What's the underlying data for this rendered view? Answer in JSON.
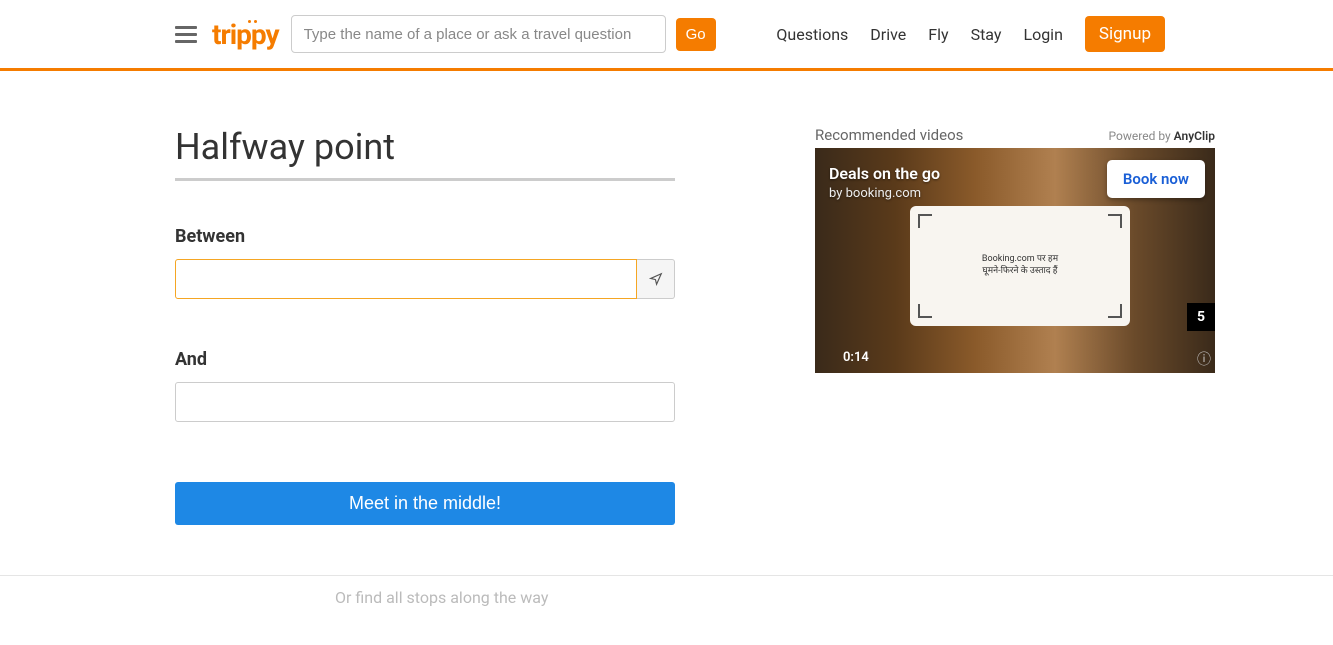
{
  "header": {
    "logo": "trippy",
    "search_placeholder": "Type the name of a place or ask a travel question",
    "go_label": "Go",
    "nav": {
      "questions": "Questions",
      "drive": "Drive",
      "fly": "Fly",
      "stay": "Stay",
      "login": "Login",
      "signup": "Signup"
    }
  },
  "form": {
    "title": "Halfway point",
    "between_label": "Between",
    "and_label": "And",
    "submit_label": "Meet in the middle!",
    "find_stops_label": "Or find all stops along the way"
  },
  "video": {
    "recommended_label": "Recommended videos",
    "powered_prefix": "Powered by ",
    "powered_brand": "AnyClip",
    "title": "Deals on the go",
    "subtitle": "by booking.com",
    "book_label": "Book now",
    "card_text_line1": "Booking.com पर हम",
    "card_text_line2": "घूमने-फिरने के उस्ताद हैं",
    "countdown": "5",
    "time": "0:14"
  }
}
